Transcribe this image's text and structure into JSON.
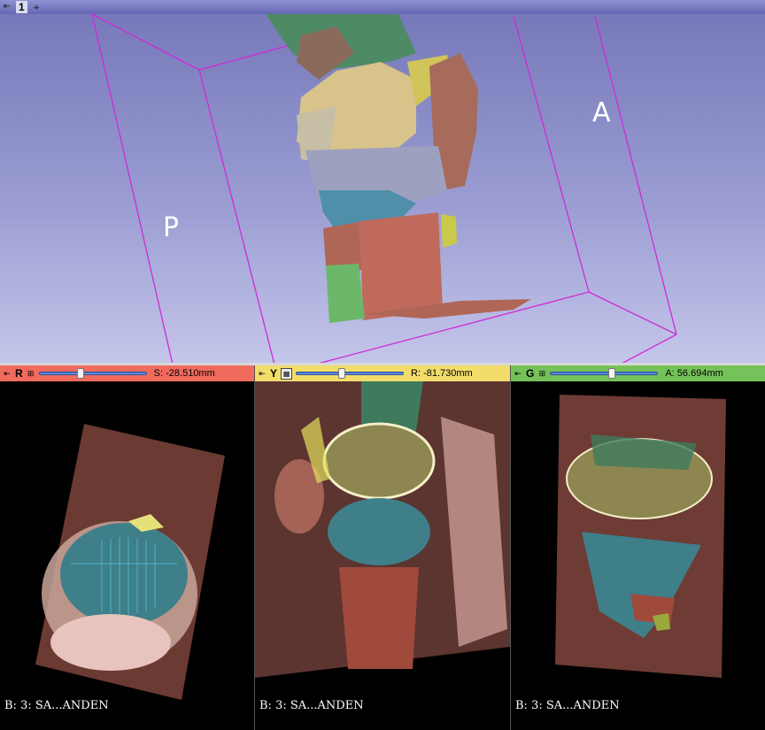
{
  "view3d": {
    "view_number": "1",
    "orientation_left": "P",
    "orientation_right": "A",
    "icons": {
      "pin": "pin-icon",
      "center": "center-view-icon"
    }
  },
  "slices": {
    "red": {
      "label": "R",
      "offset": "S: -28.510mm",
      "slider_fraction": 0.38,
      "background": "B: 3: SA...ANDEN",
      "color": "#f06a5e"
    },
    "yellow": {
      "label": "Y",
      "offset": "R: -81.730mm",
      "slider_fraction": 0.42,
      "background": "B: 3: SA...ANDEN",
      "color": "#f2dd6a"
    },
    "green": {
      "label": "G",
      "offset": "A: 56.694mm",
      "slider_fraction": 0.58,
      "background": "B: 3: SA...ANDEN",
      "color": "#76c25a"
    }
  }
}
